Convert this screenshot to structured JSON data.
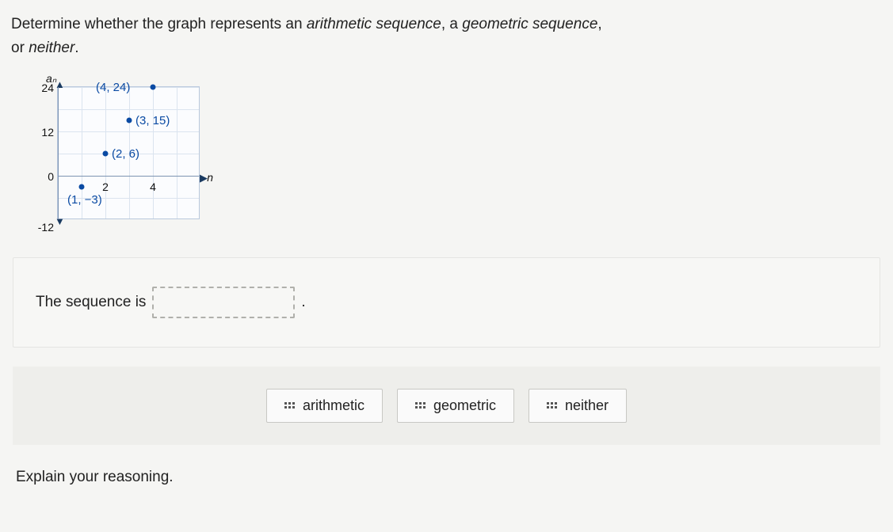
{
  "question": {
    "line1_a": "Determine whether the graph represents an ",
    "line1_b": "arithmetic sequence",
    "line1_c": ", a ",
    "line1_d": "geometric sequence",
    "line1_e": ",",
    "line2_a": "or ",
    "line2_b": "neither",
    "line2_c": "."
  },
  "answer": {
    "prefix": "The sequence is",
    "period": "."
  },
  "choices": [
    "arithmetic",
    "geometric",
    "neither"
  ],
  "explain": "Explain your reasoning.",
  "chart_data": {
    "type": "scatter",
    "xlabel": "n",
    "ylabel": "aₙ",
    "xlim": [
      0,
      5
    ],
    "ylim": [
      -12,
      24
    ],
    "x_ticks": [
      0,
      2,
      4
    ],
    "y_ticks": [
      -12,
      0,
      12,
      24
    ],
    "points": [
      {
        "n": 1,
        "a": -3,
        "label": "(1, −3)"
      },
      {
        "n": 2,
        "a": 6,
        "label": "(2, 6)"
      },
      {
        "n": 3,
        "a": 15,
        "label": "(3, 15)"
      },
      {
        "n": 4,
        "a": 24,
        "label": "(4, 24)"
      }
    ]
  }
}
